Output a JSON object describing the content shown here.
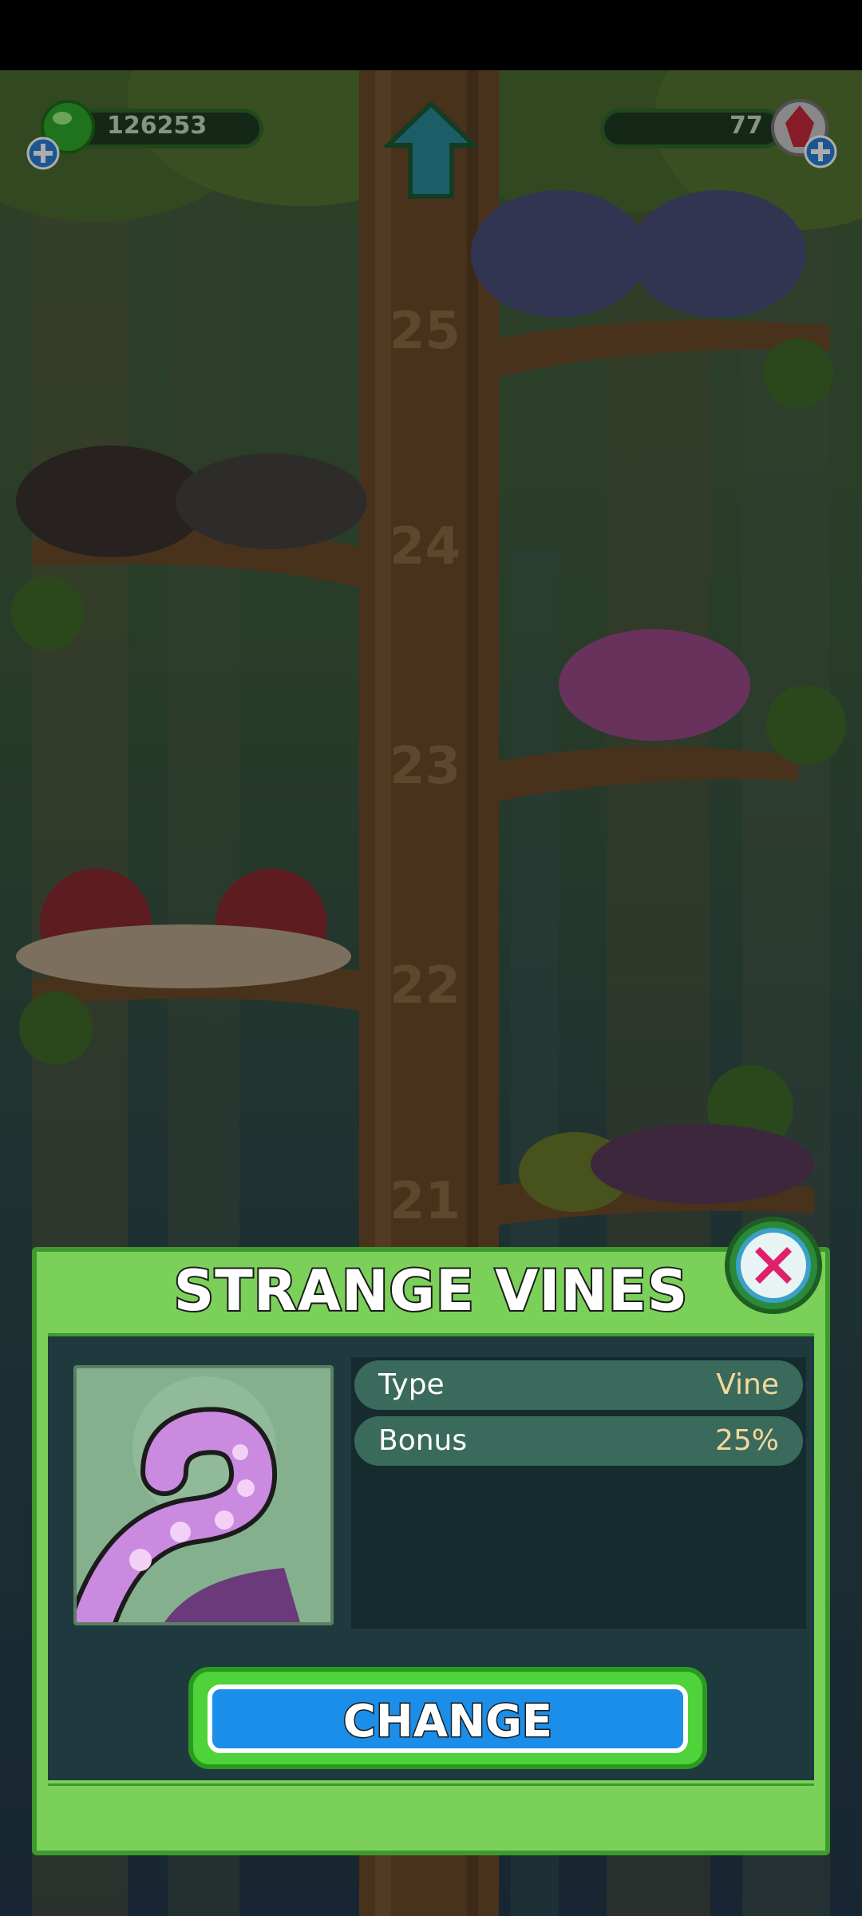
{
  "hud": {
    "coins": "126253",
    "gems": "77"
  },
  "tree": {
    "level_numbers": [
      "25",
      "24",
      "23",
      "22",
      "21"
    ]
  },
  "panel": {
    "title": "STRANGE VINES",
    "rows": [
      {
        "label": "Type",
        "value": "Vine"
      },
      {
        "label": "Bonus",
        "value": "25%"
      }
    ],
    "button_label": "CHANGE"
  },
  "icons": {
    "coin": "green-gem-icon",
    "gem": "red-crystal-icon",
    "plus": "plus-icon",
    "up": "up-arrow-icon",
    "close": "close-icon",
    "item": "tentacle-vine-icon"
  },
  "colors": {
    "panel_green": "#7bd05a",
    "panel_border": "#3f9a2e",
    "button_blue": "#1a8ee8",
    "value_gold": "#f4d79b"
  }
}
